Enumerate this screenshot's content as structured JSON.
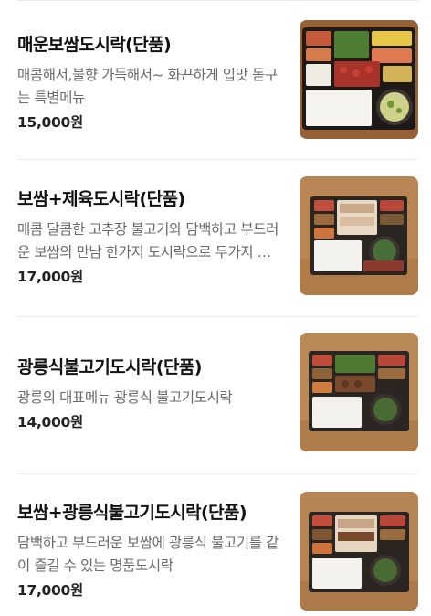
{
  "menu": {
    "items": [
      {
        "name": "매운보쌈도시락(단품)",
        "description": "매콤해서,불향 가득해서~ 화끈하게 입맛 돋구는 특별메뉴",
        "price": "15,000원",
        "image_alt": "매운보쌈도시락 사진"
      },
      {
        "name": "보쌈+제육도시락(단품)",
        "description": "매콤 달콤한 고추장 불고기와 담백하고 부드러운 보쌈의 만남 한가지 도시락으로 두가지 맛을 즐길 수 있는 메뉴",
        "price": "17,000원",
        "image_alt": "보쌈+제육도시락 사진"
      },
      {
        "name": "광릉식불고기도시락(단품)",
        "description": "광릉의 대표메뉴 광릉식 불고기도시락",
        "price": "14,000원",
        "image_alt": "광릉식불고기도시락 사진"
      },
      {
        "name": "보쌈+광릉식불고기도시락(단품)",
        "description": "담백하고 부드러운 보쌈에 광릉식 불고기를 같이 즐길 수 있는 명품도시락",
        "price": "17,000원",
        "image_alt": "보쌈+광릉식불고기도시락 사진"
      }
    ]
  },
  "colors": {
    "wood": "#b8864e",
    "box": "#2a2421",
    "rice": "#f4f2ec",
    "meat": "#b8473a",
    "greens": "#5d8a3a"
  }
}
